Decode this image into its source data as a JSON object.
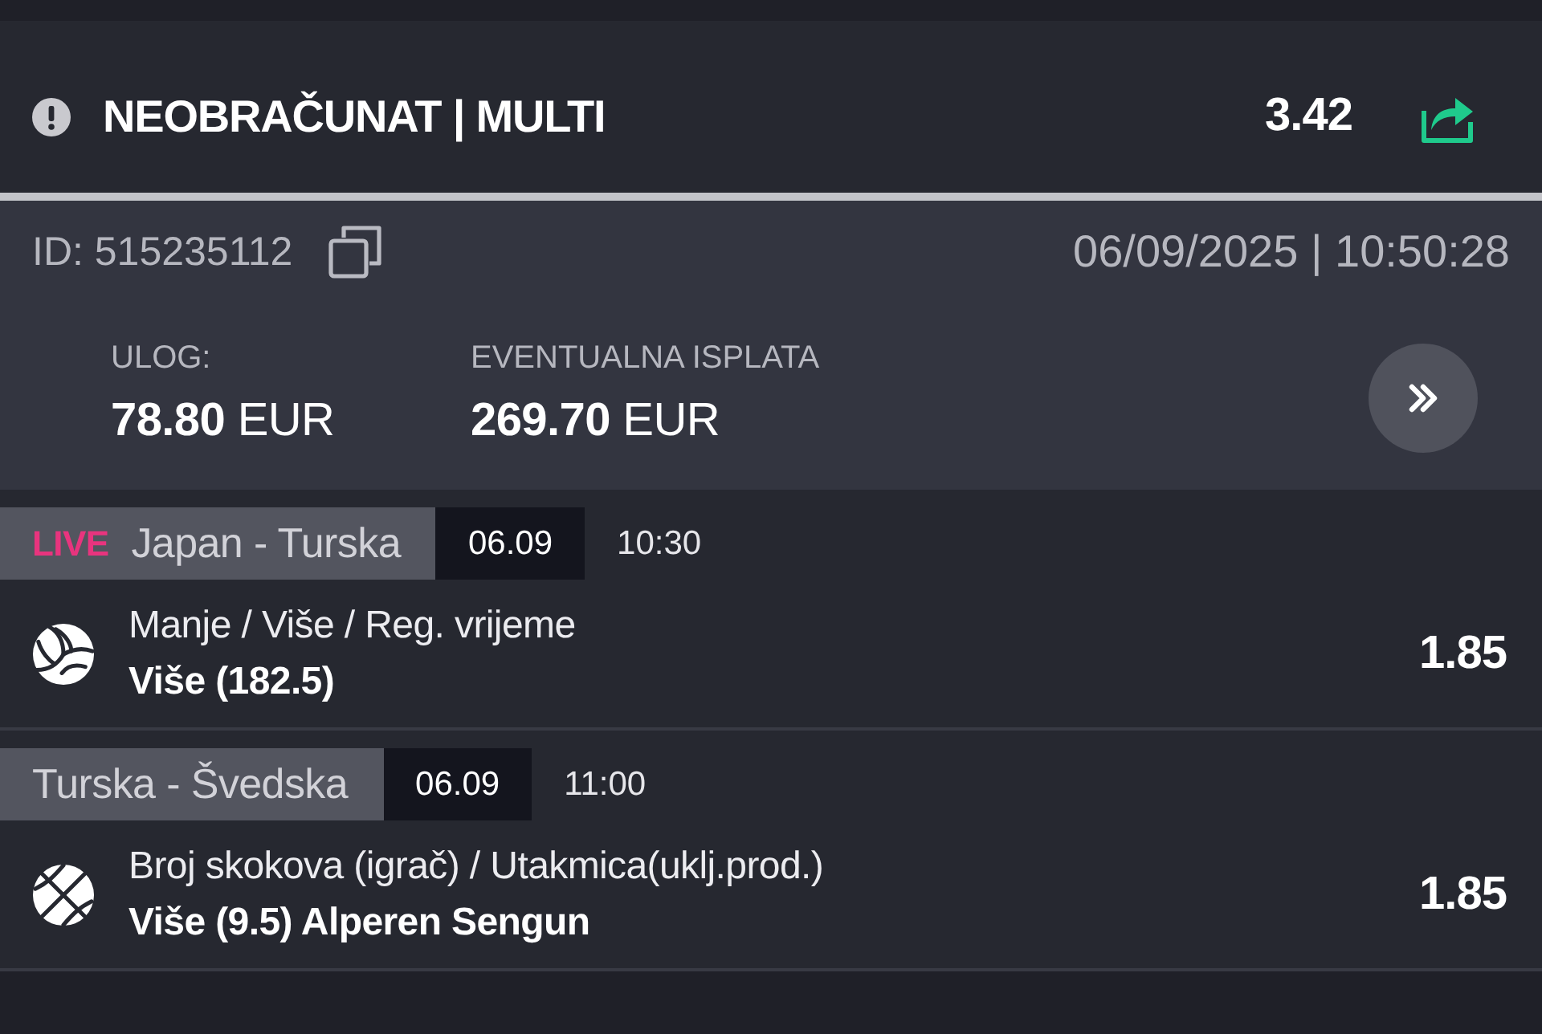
{
  "header": {
    "status": "NEOBRAČUNAT | MULTI",
    "total_odds": "3.42"
  },
  "ticket": {
    "id": "ID: 515235112",
    "datetime": "06/09/2025 | 10:50:28",
    "stake": {
      "label": "ULOG:",
      "amount": "**78.80** EUR"
    },
    "payout": {
      "label": "EVENTUALNA ISPLATA",
      "amount": "**269.70** EUR"
    }
  },
  "events": [
    {
      "badge": "LIVE",
      "match": "Japan - Turska",
      "date": "06.09",
      "time": "10:30",
      "kind": "volleyball",
      "market": "Manje / Više / Reg. vrijeme",
      "pick": "Više (182.5)",
      "odds": "1.85"
    },
    {
      "match": "Turska - Švedska",
      "date": "06.09",
      "time": "11:00",
      "kind": "basketball",
      "market": "Broj skokova (igrač) / Utakmica(uklj.prod.)",
      "pick": "Više (9.5) Alperen Sengun",
      "odds": "1.85"
    }
  ]
}
